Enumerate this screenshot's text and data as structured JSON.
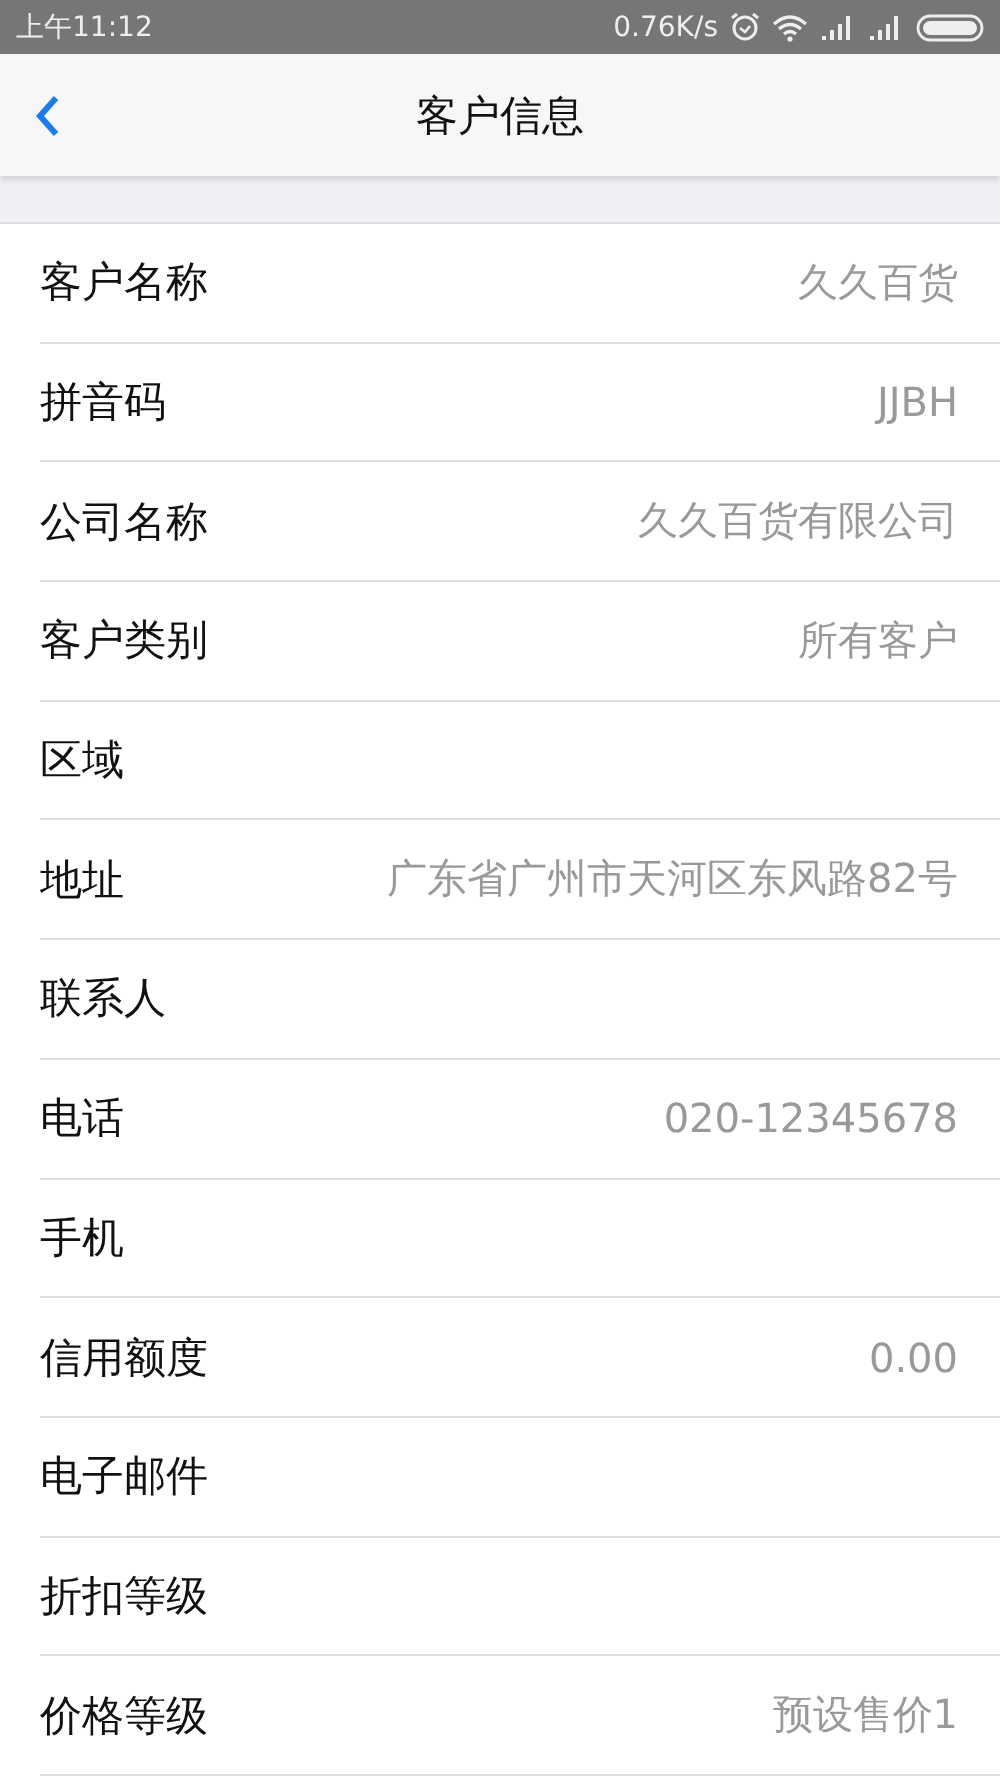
{
  "status_bar": {
    "time": "上午11:12",
    "speed": "0.76K/s"
  },
  "nav_bar": {
    "title": "客户信息"
  },
  "fields": [
    {
      "label": "客户名称",
      "value": "久久百货"
    },
    {
      "label": "拼音码",
      "value": "JJBH"
    },
    {
      "label": "公司名称",
      "value": "久久百货有限公司"
    },
    {
      "label": "客户类别",
      "value": "所有客户"
    },
    {
      "label": "区域"
    },
    {
      "label": "地址",
      "value": "广东省广州市天河区东风路82号"
    },
    {
      "label": "联系人"
    },
    {
      "label": "电话",
      "value": "020-12345678"
    },
    {
      "label": "手机"
    },
    {
      "label": "信用额度",
      "value": "0.00"
    },
    {
      "label": "电子邮件"
    },
    {
      "label": "折扣等级"
    },
    {
      "label": "价格等级",
      "value": "预设售价1"
    }
  ]
}
